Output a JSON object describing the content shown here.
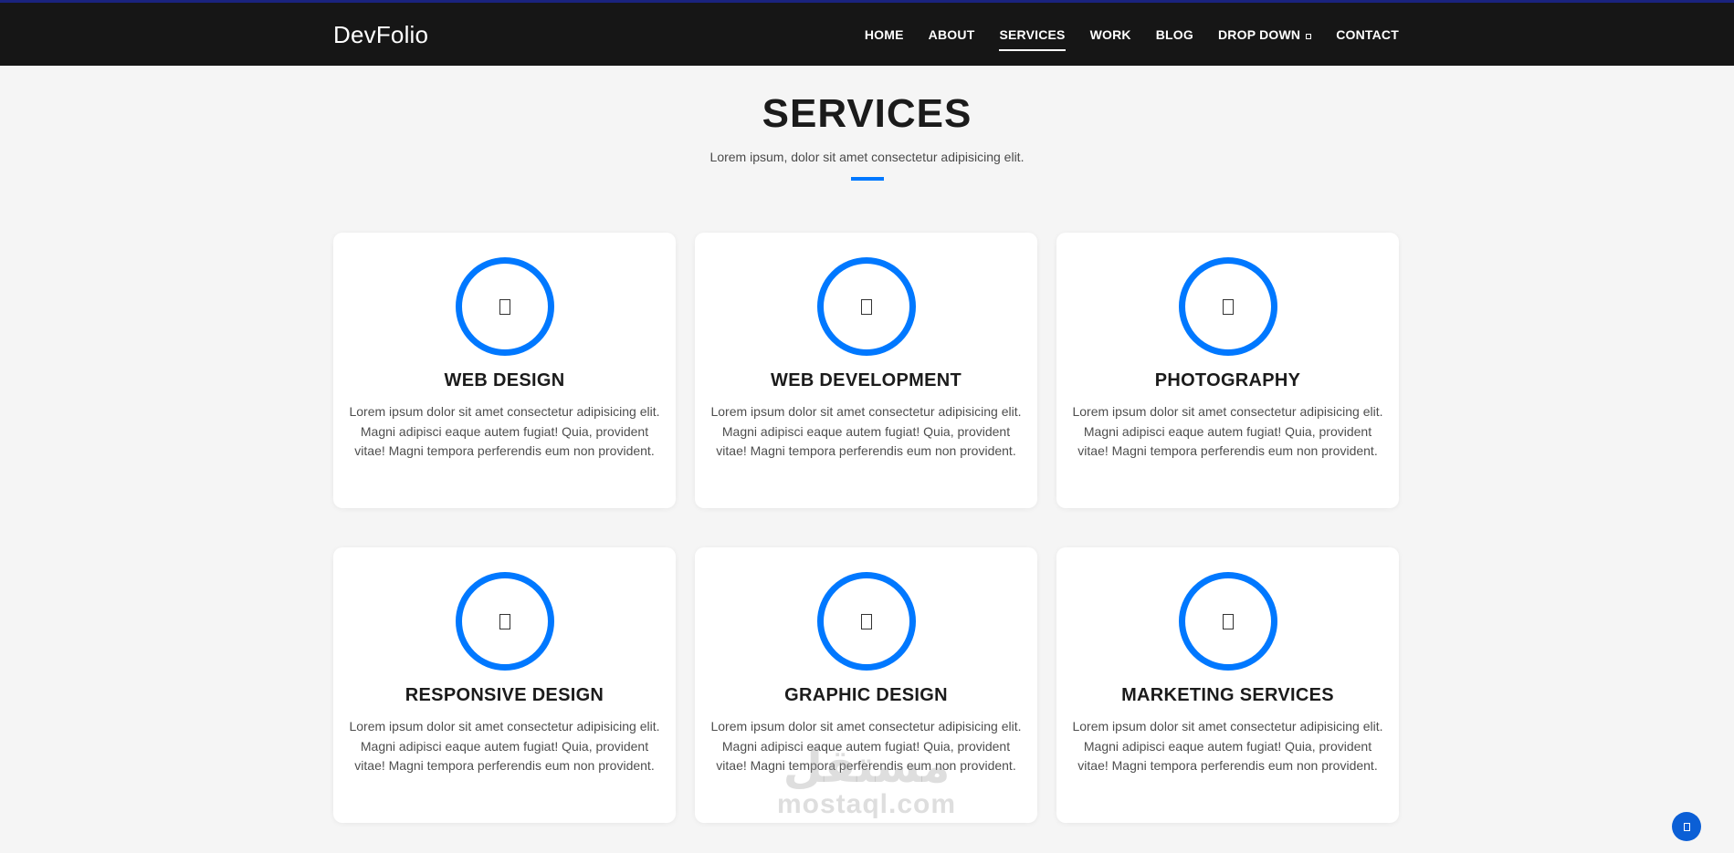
{
  "brand": "DevFolio",
  "nav": {
    "items": [
      {
        "label": "HOME",
        "active": false
      },
      {
        "label": "ABOUT",
        "active": false
      },
      {
        "label": "SERVICES",
        "active": true
      },
      {
        "label": "WORK",
        "active": false
      },
      {
        "label": "BLOG",
        "active": false
      },
      {
        "label": "DROP DOWN",
        "active": false,
        "icon": "chevron-down-icon"
      },
      {
        "label": "CONTACT",
        "active": false
      }
    ]
  },
  "section": {
    "title": "SERVICES",
    "subtitle": "Lorem ipsum, dolor sit amet consectetur adipisicing elit."
  },
  "services": [
    {
      "icon": "service-icon",
      "title": "WEB DESIGN",
      "text": "Lorem ipsum dolor sit amet consectetur adipisicing elit. Magni adipisci eaque autem fugiat! Quia, provident vitae! Magni tempora perferendis eum non provident."
    },
    {
      "icon": "service-icon",
      "title": "WEB DEVELOPMENT",
      "text": "Lorem ipsum dolor sit amet consectetur adipisicing elit. Magni adipisci eaque autem fugiat! Quia, provident vitae! Magni tempora perferendis eum non provident."
    },
    {
      "icon": "service-icon",
      "title": "PHOTOGRAPHY",
      "text": "Lorem ipsum dolor sit amet consectetur adipisicing elit. Magni adipisci eaque autem fugiat! Quia, provident vitae! Magni tempora perferendis eum non provident."
    },
    {
      "icon": "service-icon",
      "title": "RESPONSIVE DESIGN",
      "text": "Lorem ipsum dolor sit amet consectetur adipisicing elit. Magni adipisci eaque autem fugiat! Quia, provident vitae! Magni tempora perferendis eum non provident."
    },
    {
      "icon": "service-icon",
      "title": "GRAPHIC DESIGN",
      "text": "Lorem ipsum dolor sit amet consectetur adipisicing elit. Magni adipisci eaque autem fugiat! Quia, provident vitae! Magni tempora perferendis eum non provident."
    },
    {
      "icon": "service-icon",
      "title": "MARKETING SERVICES",
      "text": "Lorem ipsum dolor sit amet consectetur adipisicing elit. Magni adipisci eaque autem fugiat! Quia, provident vitae! Magni tempora perferendis eum non provident."
    }
  ],
  "watermark": {
    "logo": "مستقل",
    "text": "mostaql.com"
  },
  "colors": {
    "accent": "#0078ff",
    "navbar": "#161616",
    "background": "#f5f5f5"
  }
}
